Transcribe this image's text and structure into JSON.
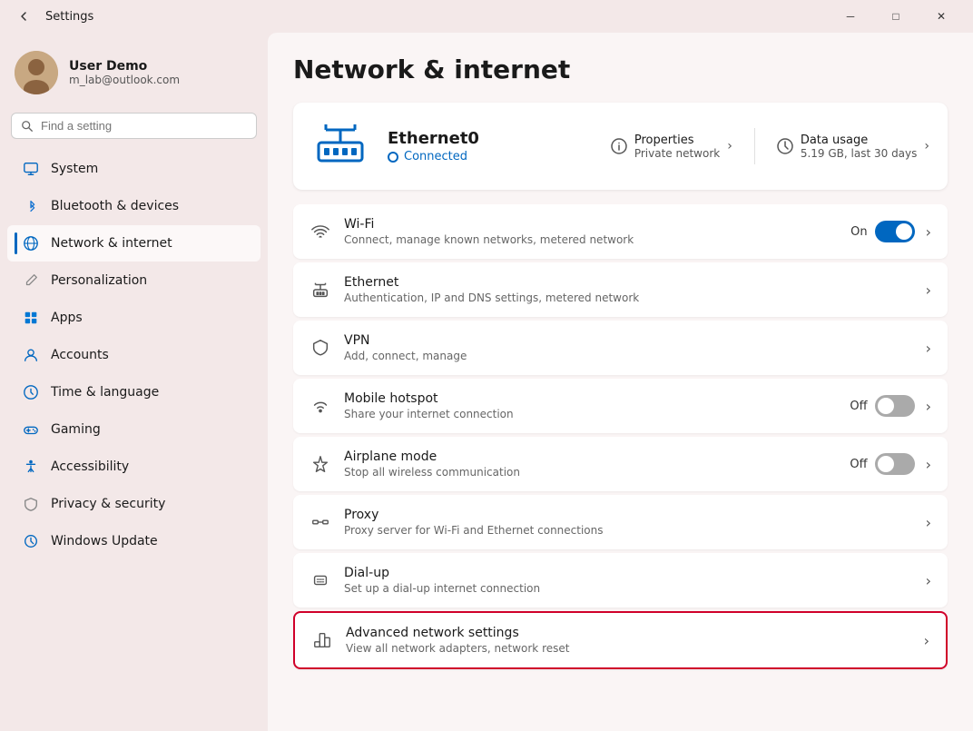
{
  "window": {
    "title": "Settings",
    "controls": {
      "minimize": "─",
      "maximize": "□",
      "close": "✕"
    }
  },
  "sidebar": {
    "user": {
      "name": "User Demo",
      "email": "m_lab@outlook.com"
    },
    "search": {
      "placeholder": "Find a setting"
    },
    "nav": [
      {
        "id": "system",
        "label": "System",
        "icon": "monitor",
        "active": false
      },
      {
        "id": "bluetooth",
        "label": "Bluetooth & devices",
        "icon": "bluetooth",
        "active": false
      },
      {
        "id": "network",
        "label": "Network & internet",
        "icon": "network",
        "active": true
      },
      {
        "id": "personalization",
        "label": "Personalization",
        "icon": "brush",
        "active": false
      },
      {
        "id": "apps",
        "label": "Apps",
        "icon": "apps",
        "active": false
      },
      {
        "id": "accounts",
        "label": "Accounts",
        "icon": "person",
        "active": false
      },
      {
        "id": "time",
        "label": "Time & language",
        "icon": "clock",
        "active": false
      },
      {
        "id": "gaming",
        "label": "Gaming",
        "icon": "gamepad",
        "active": false
      },
      {
        "id": "accessibility",
        "label": "Accessibility",
        "icon": "accessibility",
        "active": false
      },
      {
        "id": "privacy",
        "label": "Privacy & security",
        "icon": "shield",
        "active": false
      },
      {
        "id": "update",
        "label": "Windows Update",
        "icon": "update",
        "active": false
      }
    ]
  },
  "main": {
    "page_title": "Network & internet",
    "hero": {
      "title": "Ethernet0",
      "status": "Connected",
      "actions": [
        {
          "id": "properties",
          "icon": "info",
          "title": "Properties",
          "sub": "Private network"
        },
        {
          "id": "data-usage",
          "icon": "data",
          "title": "Data usage",
          "sub": "5.19 GB, last 30 days"
        }
      ]
    },
    "settings_items": [
      {
        "id": "wifi",
        "icon": "wifi",
        "title": "Wi-Fi",
        "sub": "Connect, manage known networks, metered network",
        "control": "toggle",
        "toggle_state": "on",
        "toggle_label": "On"
      },
      {
        "id": "ethernet",
        "icon": "ethernet",
        "title": "Ethernet",
        "sub": "Authentication, IP and DNS settings, metered network",
        "control": "chevron"
      },
      {
        "id": "vpn",
        "icon": "vpn",
        "title": "VPN",
        "sub": "Add, connect, manage",
        "control": "chevron"
      },
      {
        "id": "hotspot",
        "icon": "hotspot",
        "title": "Mobile hotspot",
        "sub": "Share your internet connection",
        "control": "toggle",
        "toggle_state": "off",
        "toggle_label": "Off"
      },
      {
        "id": "airplane",
        "icon": "airplane",
        "title": "Airplane mode",
        "sub": "Stop all wireless communication",
        "control": "toggle",
        "toggle_state": "off",
        "toggle_label": "Off"
      },
      {
        "id": "proxy",
        "icon": "proxy",
        "title": "Proxy",
        "sub": "Proxy server for Wi-Fi and Ethernet connections",
        "control": "chevron"
      },
      {
        "id": "dialup",
        "icon": "dialup",
        "title": "Dial-up",
        "sub": "Set up a dial-up internet connection",
        "control": "chevron"
      },
      {
        "id": "advanced",
        "icon": "advanced",
        "title": "Advanced network settings",
        "sub": "View all network adapters, network reset",
        "control": "chevron",
        "highlighted": true
      }
    ]
  }
}
